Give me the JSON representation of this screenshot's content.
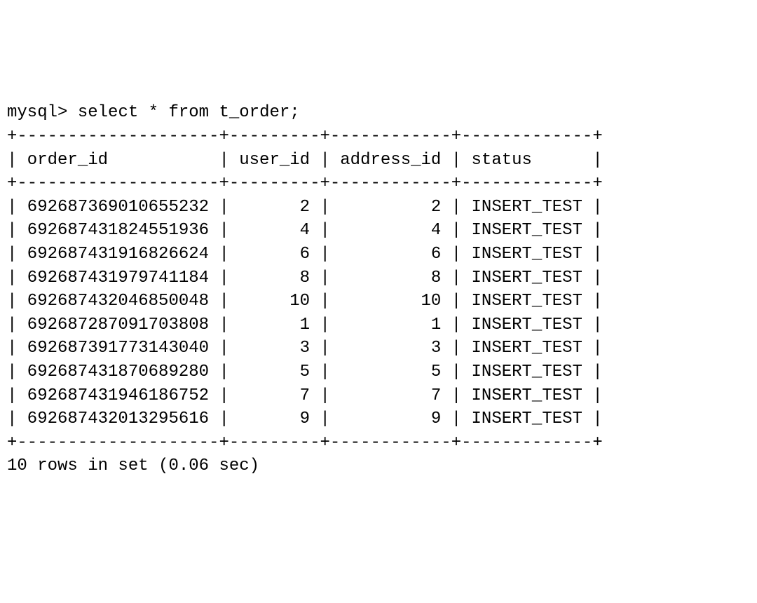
{
  "prompt": "mysql> ",
  "query": "select * from t_order;",
  "border_top": "+--------------------+---------+------------+-------------+",
  "header_line": "| order_id           | user_id | address_id | status      |",
  "border_mid": "+--------------------+---------+------------+-------------+",
  "columns": [
    "order_id",
    "user_id",
    "address_id",
    "status"
  ],
  "rows": [
    {
      "order_id": "692687369010655232",
      "user_id": 2,
      "address_id": 2,
      "status": "INSERT_TEST"
    },
    {
      "order_id": "692687431824551936",
      "user_id": 4,
      "address_id": 4,
      "status": "INSERT_TEST"
    },
    {
      "order_id": "692687431916826624",
      "user_id": 6,
      "address_id": 6,
      "status": "INSERT_TEST"
    },
    {
      "order_id": "692687431979741184",
      "user_id": 8,
      "address_id": 8,
      "status": "INSERT_TEST"
    },
    {
      "order_id": "692687432046850048",
      "user_id": 10,
      "address_id": 10,
      "status": "INSERT_TEST"
    },
    {
      "order_id": "692687287091703808",
      "user_id": 1,
      "address_id": 1,
      "status": "INSERT_TEST"
    },
    {
      "order_id": "692687391773143040",
      "user_id": 3,
      "address_id": 3,
      "status": "INSERT_TEST"
    },
    {
      "order_id": "692687431870689280",
      "user_id": 5,
      "address_id": 5,
      "status": "INSERT_TEST"
    },
    {
      "order_id": "692687431946186752",
      "user_id": 7,
      "address_id": 7,
      "status": "INSERT_TEST"
    },
    {
      "order_id": "692687432013295616",
      "user_id": 9,
      "address_id": 9,
      "status": "INSERT_TEST"
    }
  ],
  "row_lines": [
    "| 692687369010655232 |       2 |          2 | INSERT_TEST |",
    "| 692687431824551936 |       4 |          4 | INSERT_TEST |",
    "| 692687431916826624 |       6 |          6 | INSERT_TEST |",
    "| 692687431979741184 |       8 |          8 | INSERT_TEST |",
    "| 692687432046850048 |      10 |         10 | INSERT_TEST |",
    "| 692687287091703808 |       1 |          1 | INSERT_TEST |",
    "| 692687391773143040 |       3 |          3 | INSERT_TEST |",
    "| 692687431870689280 |       5 |          5 | INSERT_TEST |",
    "| 692687431946186752 |       7 |          7 | INSERT_TEST |",
    "| 692687432013295616 |       9 |          9 | INSERT_TEST |"
  ],
  "border_bot": "+--------------------+---------+------------+-------------+",
  "summary": "10 rows in set (0.06 sec)"
}
